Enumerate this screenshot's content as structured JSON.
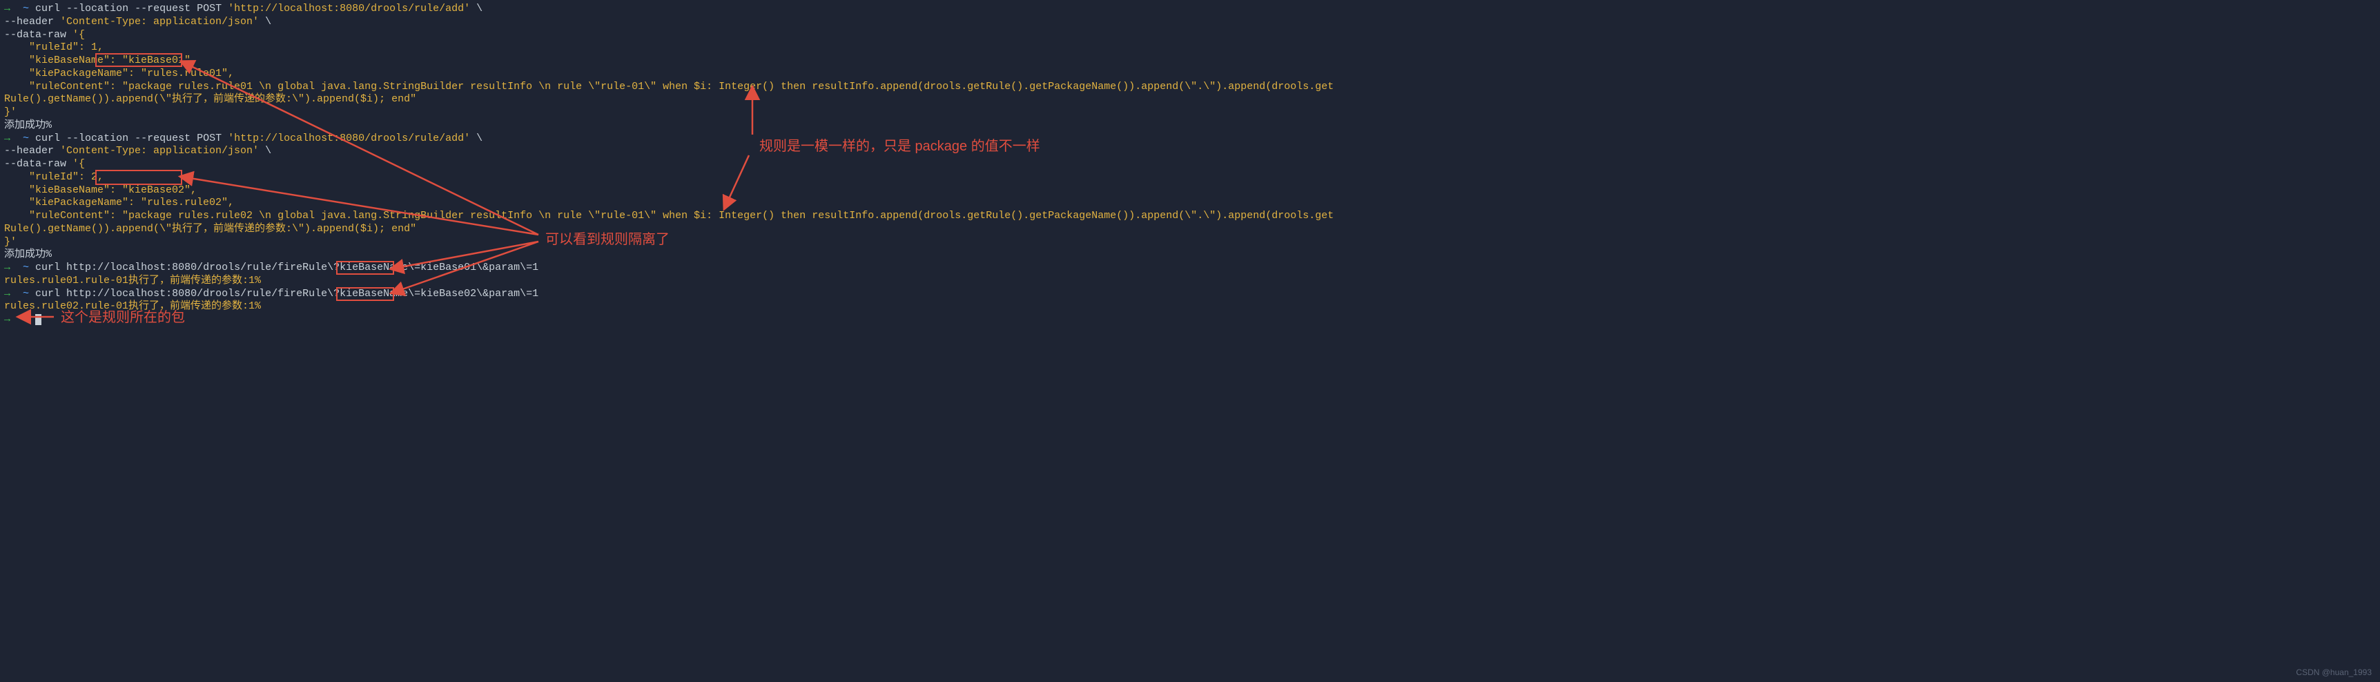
{
  "prompt": {
    "arrow": "→",
    "tilde": "~"
  },
  "curl1": {
    "l1_a": " curl --location --request POST ",
    "l1_b": "'http://localhost:8080/drools/rule/add'",
    "l1_c": " \\",
    "l2_a": "--header ",
    "l2_b": "'Content-Type: application/json'",
    "l2_c": " \\",
    "l3_a": "--data-raw ",
    "l3_b": "'{",
    "l4": "    \"ruleId\": 1,",
    "l5_a": "    \"kieBaseName\":",
    "l5_b": " \"kieBase01\",",
    "l6": "    \"kiePackageName\": \"rules.rule01\",",
    "l7": "    \"ruleContent\": \"package rules.rule01 \\n global java.lang.StringBuilder resultInfo \\n rule \\\"rule-01\\\" when $i: Integer() then resultInfo.append(drools.getRule().getPackageName()).append(\\\".\\\").append(drools.get",
    "l8": "Rule().getName()).append(\\\"执行了，前端传递的参数:\\\").append($i); end\"",
    "l9": "}'"
  },
  "out1": "添加成功%",
  "curl2": {
    "l1_a": " curl --location --request POST ",
    "l1_b": "'http://localhost:8080/drools/rule/add'",
    "l1_c": " \\",
    "l2_a": "--header ",
    "l2_b": "'Content-Type: application/json'",
    "l2_c": " \\",
    "l3_a": "--data-raw ",
    "l3_b": "'{",
    "l4": "    \"ruleId\": 2,",
    "l5_a": "    \"kieBaseName\":",
    "l5_b": " \"kieBase02\",",
    "l6": "    \"kiePackageName\": \"rules.rule02\",",
    "l7": "    \"ruleContent\": \"package rules.rule02 \\n global java.lang.StringBuilder resultInfo \\n rule \\\"rule-01\\\" when $i: Integer() then resultInfo.append(drools.getRule().getPackageName()).append(\\\".\\\").append(drools.get",
    "l8": "Rule().getName()).append(\\\"执行了，前端传递的参数:\\\").append($i); end\"",
    "l9": "}'"
  },
  "out2": "添加成功%",
  "curl3": " curl http://localhost:8080/drools/rule/fireRule\\?kieBaseName\\=kieBase01\\&param\\=1",
  "out3": "rules.rule01.rule-01执行了，前端传递的参数:1%",
  "curl4": " curl http://localhost:8080/drools/rule/fireRule\\?kieBaseName\\=kieBase02\\&param\\=1",
  "out4": "rules.rule02.rule-01执行了，前端传递的参数:1%",
  "annotations": {
    "rules_same": "规则是一模一样的，只是 package 的值不一样",
    "isolated": "可以看到规则隔离了",
    "package_loc": "这个是规则所在的包"
  },
  "watermark": "CSDN @huan_1993"
}
